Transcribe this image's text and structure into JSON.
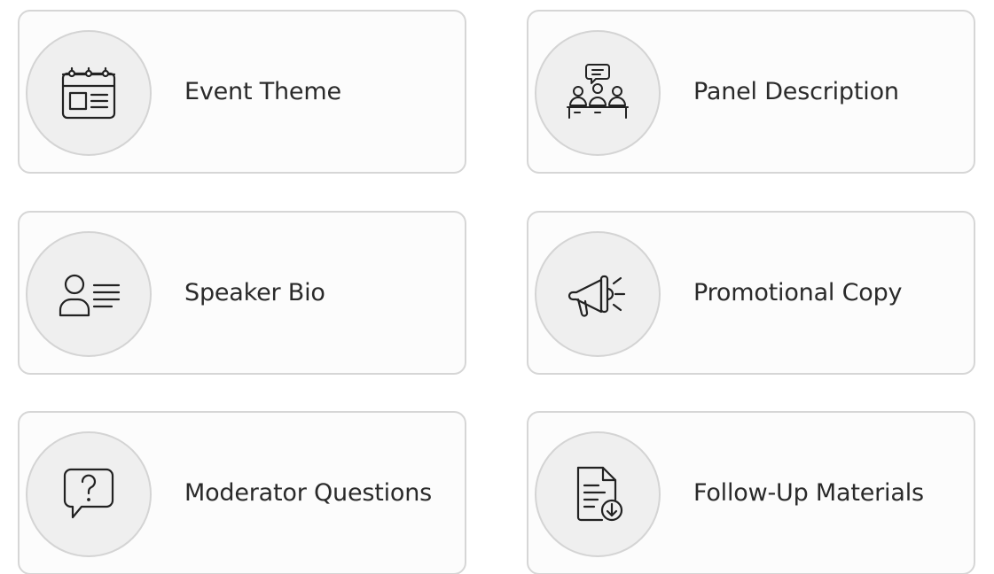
{
  "cards": [
    {
      "label": "Event Theme",
      "icon": "calendar-icon"
    },
    {
      "label": "Panel Description",
      "icon": "panel-discussion-icon"
    },
    {
      "label": "Speaker Bio",
      "icon": "speaker-profile-icon"
    },
    {
      "label": "Promotional Copy",
      "icon": "megaphone-icon"
    },
    {
      "label": "Moderator Questions",
      "icon": "question-bubble-icon"
    },
    {
      "label": "Follow-Up Materials",
      "icon": "document-download-icon"
    }
  ],
  "colors": {
    "card_border": "#d6d6d6",
    "card_background": "#fcfcfc",
    "icon_circle_background": "#efefef",
    "icon_stroke": "#222222",
    "label_text": "#2a2a2a"
  }
}
